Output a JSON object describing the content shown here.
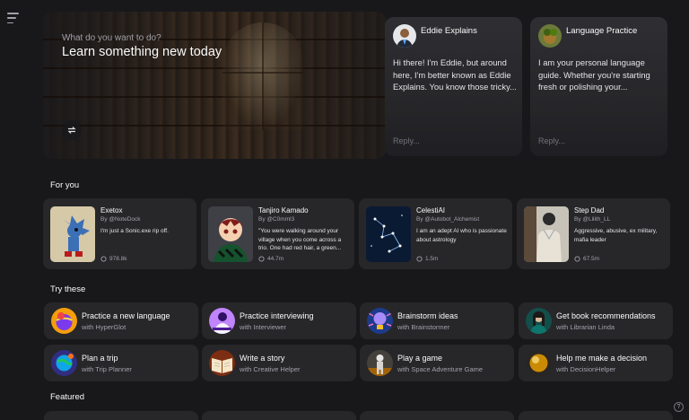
{
  "hero": {
    "subtitle": "What do you want to do?",
    "title": "Learn something new today"
  },
  "chats": [
    {
      "name": "Eddie Explains",
      "message": "Hi there! I'm Eddie, but around here, I'm better known as Eddie Explains. You know those tricky...",
      "reply": "Reply..."
    },
    {
      "name": "Language Practice",
      "message": "I am your personal language guide. Whether you're starting fresh or polishing your...",
      "reply": "Reply..."
    }
  ],
  "sections": {
    "for_you": "For you",
    "try_these": "Try these",
    "featured": "Featured"
  },
  "for_you": [
    {
      "title": "Exetox",
      "by": "By @NoteDock",
      "desc": "I'm just a Sonic.exe rip off.",
      "count": "978.8k"
    },
    {
      "title": "Tanjiro Kamado",
      "by": "By @C0mml3",
      "desc": "\"You were walking around your village when you come across a trio. One had red hair, a green...",
      "count": "44.7m"
    },
    {
      "title": "CelestiAI",
      "by": "By @Autobot_Alchemist",
      "desc": "I am an adept AI who is passionate about astrology",
      "count": "1.5m"
    },
    {
      "title": "Step Dad",
      "by": "By @Lilith_LL",
      "desc": "Aggressive, abusive, ex military, mafia leader",
      "count": "67.5m"
    }
  ],
  "try_these": [
    {
      "title": "Practice a new language",
      "with": "with HyperGlot"
    },
    {
      "title": "Practice interviewing",
      "with": "with Interviewer"
    },
    {
      "title": "Brainstorm ideas",
      "with": "with Brainstormer"
    },
    {
      "title": "Get book recommendations",
      "with": "with Librarian Linda"
    },
    {
      "title": "Plan a trip",
      "with": "with Trip Planner"
    },
    {
      "title": "Write a story",
      "with": "with Creative Helper"
    },
    {
      "title": "Play a game",
      "with": "with Space Adventure Game"
    },
    {
      "title": "Help me make a decision",
      "with": "with DecisionHelper"
    }
  ],
  "help": "?"
}
